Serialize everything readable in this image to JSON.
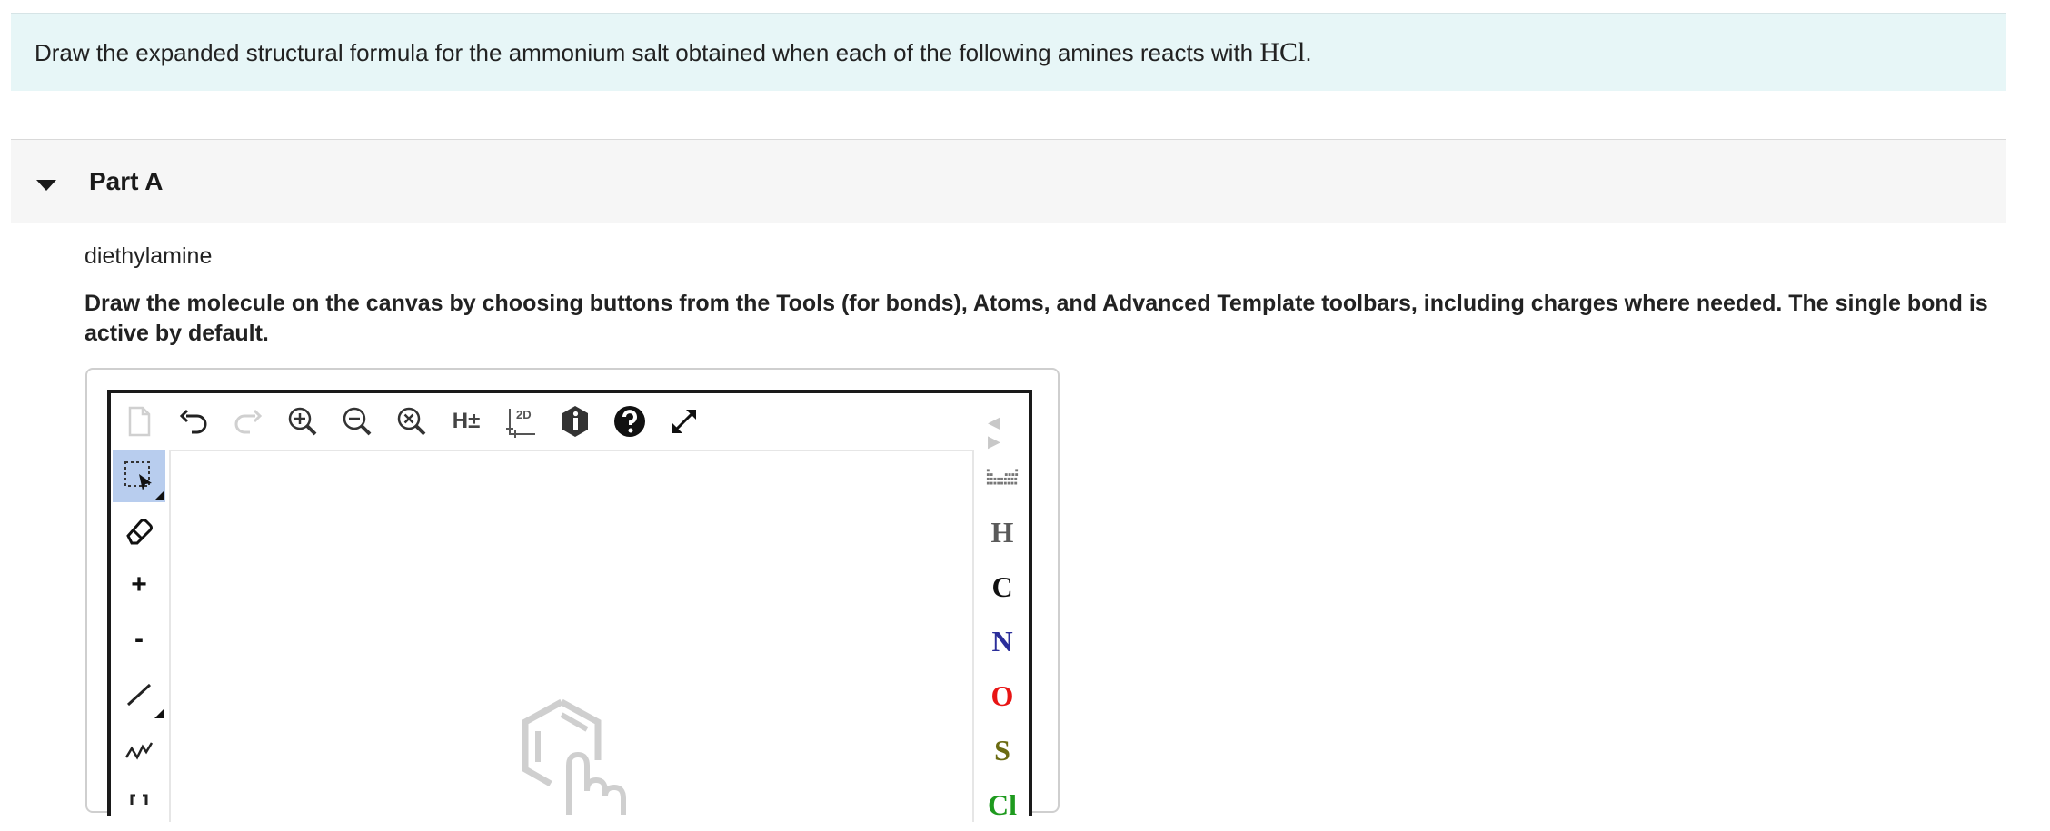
{
  "question": {
    "text": "Draw the expanded structural formula for the ammonium salt obtained when each of the following amines reacts with ",
    "formula": "HCl",
    "punct": "."
  },
  "part": {
    "title": "Part A",
    "amine": "diethylamine",
    "instructions": "Draw the molecule on the canvas by choosing buttons from the Tools (for bonds), Atoms, and Advanced Template toolbars, including charges where needed. The single bond is active by default."
  },
  "editor": {
    "top_toolbar": {
      "h_toggle": "H±",
      "clean_2d": "2D",
      "scroll_arrows": "◀ ▶"
    },
    "left_toolbar": {
      "charge_plus": "+",
      "charge_minus": "-"
    },
    "atoms": [
      {
        "symbol": "H",
        "color": "#5a5a5a"
      },
      {
        "symbol": "C",
        "color": "#111111"
      },
      {
        "symbol": "N",
        "color": "#2b2e9a"
      },
      {
        "symbol": "O",
        "color": "#e81414"
      },
      {
        "symbol": "S",
        "color": "#6b6b12"
      },
      {
        "symbol": "Cl",
        "color": "#1e9a1e"
      }
    ]
  }
}
